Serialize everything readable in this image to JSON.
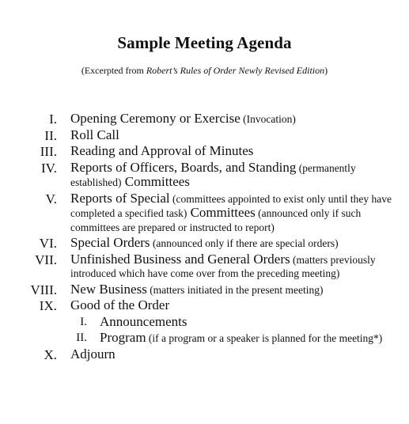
{
  "title": "Sample Meeting Agenda",
  "subtitle": {
    "prefix": "(Excerpted from ",
    "italic": "Robert’s Rules of Order Newly Revised Edition",
    "suffix": ")"
  },
  "items": [
    {
      "num": "I.",
      "main": "Opening Ceremony or Exercise",
      "note": " (Invocation)"
    },
    {
      "num": "II.",
      "main": "Roll Call"
    },
    {
      "num": "III.",
      "main": "Reading and Approval of Minutes"
    },
    {
      "num": "IV.",
      "main": "Reports of Officers, Boards, and Standing",
      "note": " (permanently established)",
      "main2": " Committees"
    },
    {
      "num": "V.",
      "main": "Reports of Special",
      "note": " (committees appointed to exist only until they have completed a specified task)",
      "main2": " Committees",
      "note2": " (announced only if such committees are prepared or instructed to report)"
    },
    {
      "num": "VI.",
      "main": "Special Orders",
      "note": " (announced only if there are special orders)"
    },
    {
      "num": "VII.",
      "main": "Unfinished Business and General Orders",
      "note": " (matters previously introduced which have come over from the preceding meeting)"
    },
    {
      "num": "VIII.",
      "main": "New Business",
      "note": " (matters initiated in the present meeting)"
    },
    {
      "num": "IX.",
      "main": "Good of the Order",
      "sub": [
        {
          "num": "I.",
          "main": "Announcements"
        },
        {
          "num": "II.",
          "main": "Program",
          "note": " (if a program or a speaker is planned for the meeting*)"
        }
      ]
    },
    {
      "num": "X.",
      "main": "Adjourn"
    }
  ]
}
